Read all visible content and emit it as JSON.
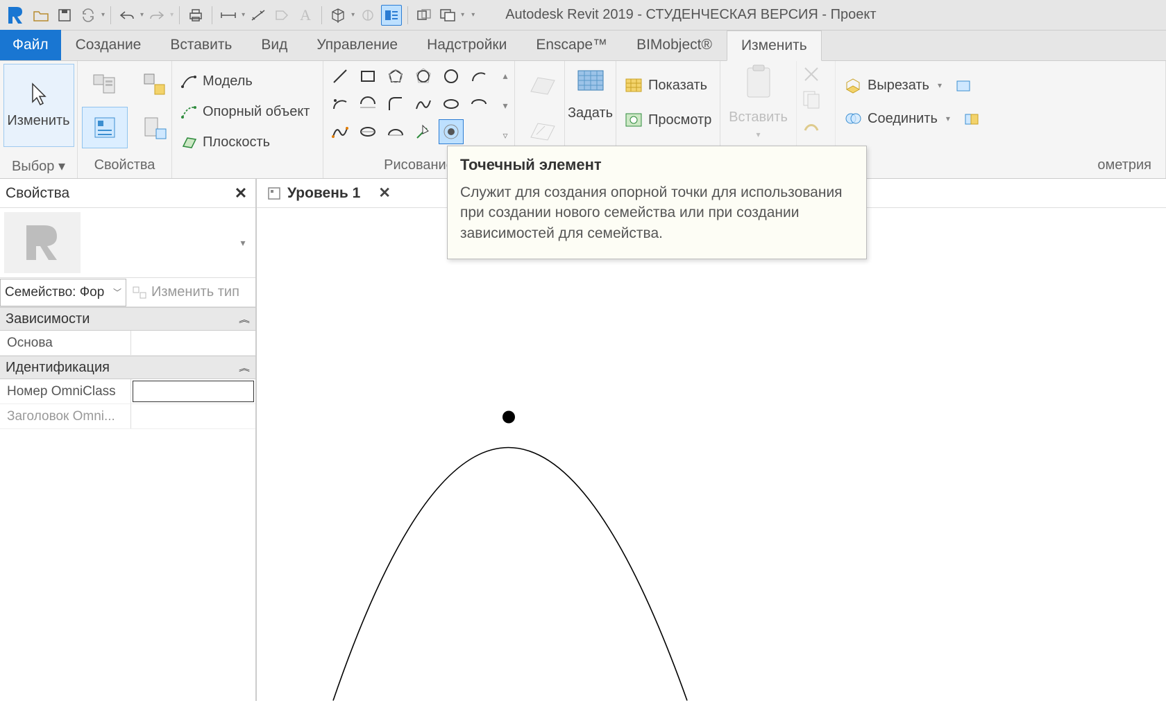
{
  "app_title": "Autodesk Revit 2019 - СТУДЕНЧЕСКАЯ ВЕРСИЯ - Проект",
  "file_tab": "Файл",
  "tabs": [
    "Создание",
    "Вставить",
    "Вид",
    "Управление",
    "Надстройки",
    "Enscape™",
    "BIMobject®",
    "Изменить"
  ],
  "panels": {
    "select": {
      "label": "Выбор ▾",
      "modify": "Изменить"
    },
    "props": {
      "label": "Свойства"
    },
    "model_btns": {
      "model": "Модель",
      "ref": "Опорный объект",
      "plane": "Плоскость"
    },
    "draw": {
      "label": "Рисование"
    },
    "set": {
      "label": "Задать"
    },
    "show": "Показать",
    "view": "Просмотр",
    "paste": {
      "label": "Вставить"
    },
    "geom": {
      "label": "ометрия",
      "cut": "Вырезать",
      "join": "Соединить"
    }
  },
  "tooltip": {
    "title": "Точечный элемент",
    "body": "Служит для создания опорной точки для использования при создании нового семейства или при создании зависимостей для семейства."
  },
  "props_pane": {
    "title": "Свойства",
    "family_selector": "Семейство: Фор",
    "edit_type": "Изменить тип",
    "sections": {
      "deps": "Зависимости",
      "base": "Основа",
      "ident": "Идентификация",
      "omni_num": "Номер OmniClass",
      "omni_title": "Заголовок Omni..."
    }
  },
  "view_tab": {
    "label": "Уровень 1"
  }
}
